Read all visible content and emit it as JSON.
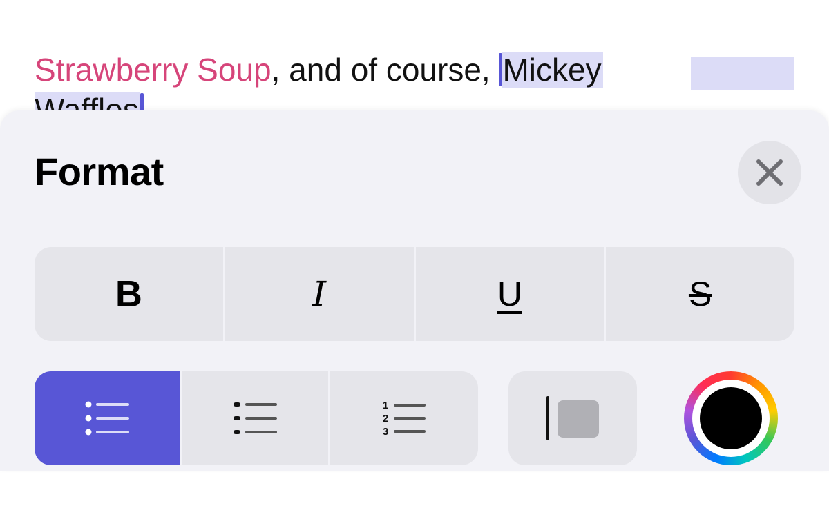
{
  "note": {
    "link_text": "Strawberry Soup",
    "middle_text": ", and of course, ",
    "selected_line1": "Mickey",
    "selected_line2": "Waffles"
  },
  "format_panel": {
    "title": "Format",
    "close_icon": "close-icon",
    "text_styles": [
      {
        "label": "B",
        "name": "bold"
      },
      {
        "label": "I",
        "name": "italic"
      },
      {
        "label": "U",
        "name": "underline"
      },
      {
        "label": "S",
        "name": "strikethrough"
      }
    ],
    "list_styles": [
      {
        "name": "bulleted-list",
        "active": true
      },
      {
        "name": "dashed-list",
        "active": false
      },
      {
        "name": "numbered-list",
        "active": false,
        "numbers": [
          "1",
          "2",
          "3"
        ]
      }
    ],
    "block_quote_icon": "block-quote-icon",
    "text_color": "#000000"
  },
  "colors": {
    "accent": "#5856d6",
    "link": "#d6457a",
    "selection": "#dcdcf7",
    "sheet_bg": "#f2f2f7",
    "button_bg": "#e5e5ea"
  }
}
